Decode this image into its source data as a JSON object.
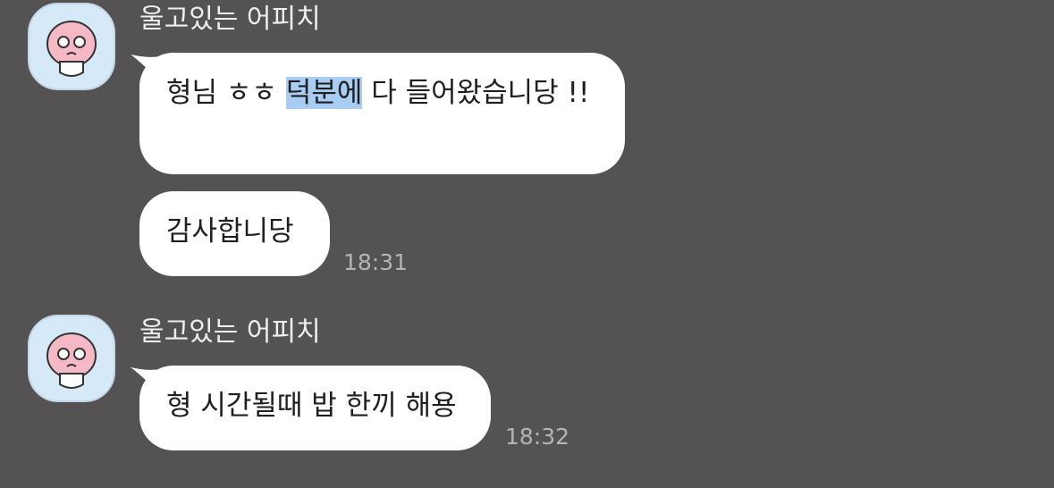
{
  "app": {
    "background_color": "#545253",
    "bubble_color": "#ffffff",
    "highlight_color": "#a9cdf2"
  },
  "messages": [
    {
      "sender": "울고있는 어피치",
      "avatar_icon": "crying-apeach-avatar-icon",
      "bubbles": [
        {
          "text_before": "형님 ㅎㅎ ",
          "text_highlight": "덕분에",
          "text_after": " 다 들어왔습니당 !!",
          "time": ""
        },
        {
          "text": "감사합니당",
          "time": "18:31"
        }
      ]
    },
    {
      "sender": "울고있는 어피치",
      "avatar_icon": "crying-apeach-avatar-icon",
      "bubbles": [
        {
          "text": "형 시간될때 밥 한끼 해용",
          "time": "18:32"
        }
      ]
    }
  ]
}
